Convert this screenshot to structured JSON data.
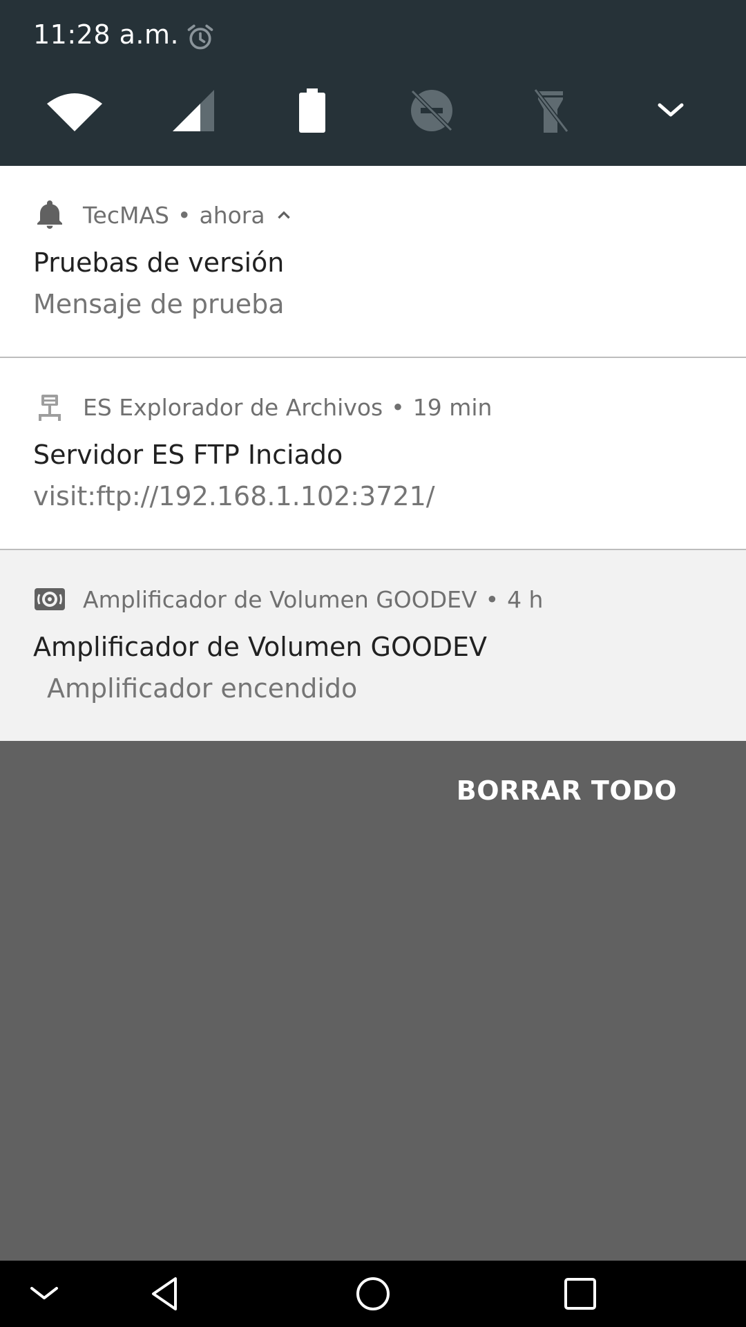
{
  "status_bar": {
    "time": "11:28 a.m.",
    "alarm_icon": "alarm-clock-icon"
  },
  "quick_settings": {
    "icons": [
      "wifi-icon",
      "signal-icon",
      "battery-icon",
      "do-not-disturb-off-icon",
      "flashlight-off-icon",
      "expand-chevron-icon"
    ]
  },
  "notifications": [
    {
      "app_icon": "bell-icon",
      "app": "TecMAS",
      "separator": "•",
      "time": "ahora",
      "title": "Pruebas de versión",
      "text": "Mensaje de prueba"
    },
    {
      "app_icon": "ftp-server-icon",
      "app": "ES Explorador de Archivos",
      "separator": "•",
      "time": "19 min",
      "title": "Servidor ES FTP Inciado",
      "text": "visit:ftp://192.168.1.102:3721/"
    },
    {
      "app_icon": "speaker-icon",
      "app": "Amplificador de Volumen GOODEV",
      "separator": "•",
      "time": "4 h",
      "title": "Amplificador de Volumen GOODEV",
      "text": "Amplificador encendido"
    }
  ],
  "actions": {
    "clear_all": "BORRAR TODO"
  },
  "colors": {
    "header": "#263238",
    "scrim": "#616161",
    "navbar": "#000000"
  }
}
